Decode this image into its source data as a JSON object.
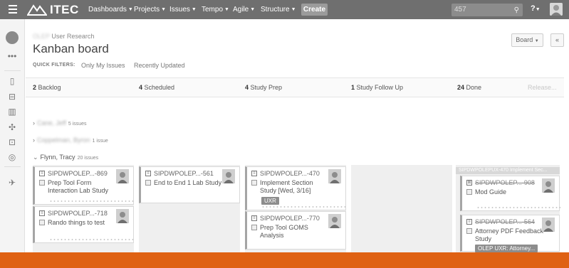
{
  "nav": {
    "brand": "ITEC",
    "items": [
      {
        "label": "Dashboards"
      },
      {
        "label": "Projects"
      },
      {
        "label": "Issues"
      },
      {
        "label": "Tempo"
      },
      {
        "label": "Agile"
      },
      {
        "label": "Structure"
      }
    ],
    "create_label": "Create",
    "search_value": "457",
    "help_label": "?"
  },
  "header": {
    "project_blur": "OLEP",
    "project_name": "User Research",
    "title": "Kanban board",
    "board_button": "Board",
    "collapse_button": "«"
  },
  "quick_filters": {
    "label": "QUICK FILTERS:",
    "items": [
      "Only My Issues",
      "Recently Updated"
    ]
  },
  "columns": [
    {
      "count": "2",
      "name": "Backlog"
    },
    {
      "count": "4",
      "name": "Scheduled"
    },
    {
      "count": "4",
      "name": "Study Prep"
    },
    {
      "count": "1",
      "name": "Study Follow Up"
    },
    {
      "count": "24",
      "name": "Done"
    }
  ],
  "release_label": "Release...",
  "swimlanes": [
    {
      "name": "Cane, Jeff",
      "count": "5 issues",
      "blurred": true
    },
    {
      "name": "Coppelman, Byron",
      "count": "1 issue",
      "blurred": true
    },
    {
      "name": "Flynn, Tracy",
      "count": "20 issues",
      "blurred": false
    }
  ],
  "cards": {
    "c869": {
      "key": "SIPDWPOLEP...-869",
      "summary": [
        "Prep Tool Form",
        "Interaction Lab Study"
      ]
    },
    "c718": {
      "key": "SIPDWPOLEP...-718",
      "summary": [
        "Rando things to test"
      ]
    },
    "c561": {
      "key": "SIPDWPOLEP...-561",
      "summary": [
        "End to End 1 Lab Study"
      ]
    },
    "c470": {
      "key": "SIPDWPOLEP...-470",
      "summary": [
        "Implement Section",
        "Study [Wed, 3/16]"
      ],
      "label": "UXR"
    },
    "c770": {
      "key": "SIPDWPOLEP...-770",
      "summary": [
        "Prep Tool GOMS",
        "Analysis"
      ]
    },
    "c908": {
      "key": "SIPDWPOLEP...-908",
      "summary": [
        "Mod Guide"
      ]
    },
    "c564": {
      "key": "SIPDWPOLEP...-564",
      "summary": [
        "Attorney PDF Feedback",
        "Study"
      ],
      "label": "OLEP UXR: Attorney..."
    }
  },
  "epic_header": "SIPDWPOLEPUX-470  Implement Sec...",
  "colors": {
    "nav_bg": "#6f6f6f",
    "footer_accent": "#df6113"
  }
}
